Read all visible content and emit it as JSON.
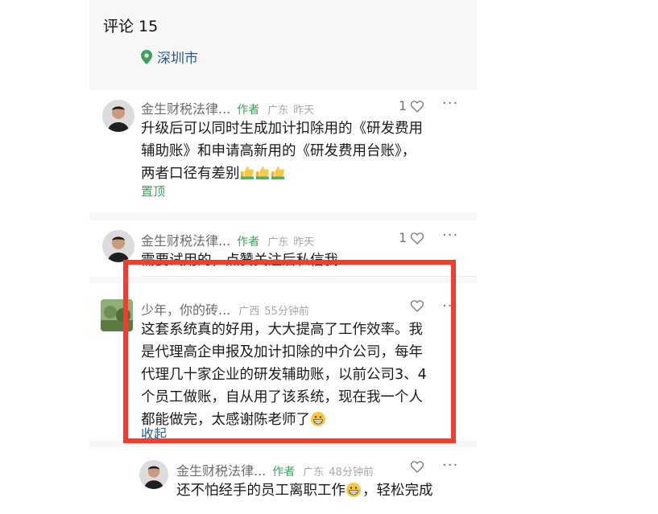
{
  "header": {
    "title": "评论 15",
    "location": "深圳市"
  },
  "comments": [
    {
      "author": "金生财税法律...",
      "badge": "作者",
      "region": "广东",
      "time": "昨天",
      "likes": "1",
      "text_lines": [
        "升级后可以同时生成加计扣除用的《研发费用",
        "辅助账》和申请高新用的《研发费用台账》，",
        "两者口径有差别"
      ],
      "emoji": [
        "thumbs-up",
        "thumbs-up",
        "thumbs-up"
      ],
      "action": "置顶"
    },
    {
      "author": "金生财税法律...",
      "badge": "作者",
      "region": "广东",
      "time": "昨天",
      "likes": "1",
      "text_lines": [
        "需要试用的，点赞关注后私信我"
      ]
    },
    {
      "author": "少年，你的砖...",
      "region": "广西",
      "time": "55分钟前",
      "text_lines": [
        "这套系统真的好用，大大提高了工作效率。我",
        "是代理高企申报及加计扣除的中介公司，每年",
        "代理几十家企业的研发辅助账，以前公司3、4",
        "个员工做账，自从用了该系统，现在我一个人",
        "都能做完，太感谢陈老师了"
      ],
      "action": "收起"
    },
    {
      "author": "金生财税法律...",
      "badge": "作者",
      "region": "广东",
      "time": "48分钟前",
      "text_lines": [
        "还不怕经手的员工离职工作",
        "，轻松完成"
      ]
    }
  ],
  "colors": {
    "accent_green": "#3aa35a",
    "link_blue": "#2b5a86",
    "highlight_red": "#f13d2d"
  }
}
